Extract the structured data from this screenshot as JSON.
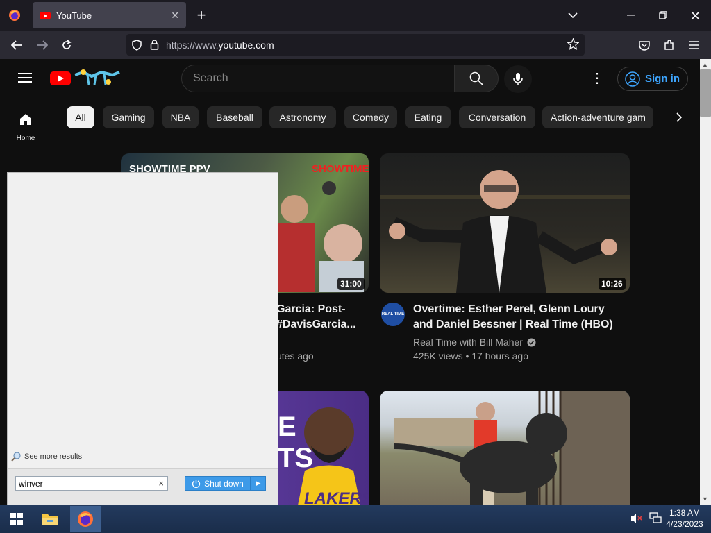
{
  "browser": {
    "tab_title": "YouTube",
    "tab_close": "✕",
    "new_tab": "+",
    "url_prefix": "https://www.",
    "url_domain": "youtube.com"
  },
  "youtube": {
    "search_placeholder": "Search",
    "sign_in": "Sign in",
    "home_label": "Home",
    "chips": [
      "All",
      "Gaming",
      "NBA",
      "Baseball",
      "Astronomy",
      "Comedy",
      "Eating",
      "Conversation",
      "Action-adventure gam"
    ],
    "videos": [
      {
        "title_line1": "Garcia: Post-",
        "title_line2": "#DavisGarcia...",
        "meta": "utes ago",
        "duration": "31:00",
        "thumb_text": "SHOWTIME PPV"
      },
      {
        "title_line1": "Overtime: Esther Perel, Glenn Loury",
        "title_line2": "and Daniel Bessner | Real Time (HBO)",
        "channel": "Real Time with Bill Maher",
        "meta": "425K views • 17 hours ago",
        "duration": "10:26",
        "avatar_text": "REAL TIME"
      }
    ],
    "lakers_text": "LAKERS"
  },
  "start_menu": {
    "see_more": "See more results",
    "search_value": "winver",
    "clear": "×",
    "shutdown": "Shut down"
  },
  "taskbar": {
    "time": "1:38 AM",
    "date": "4/23/2023"
  }
}
